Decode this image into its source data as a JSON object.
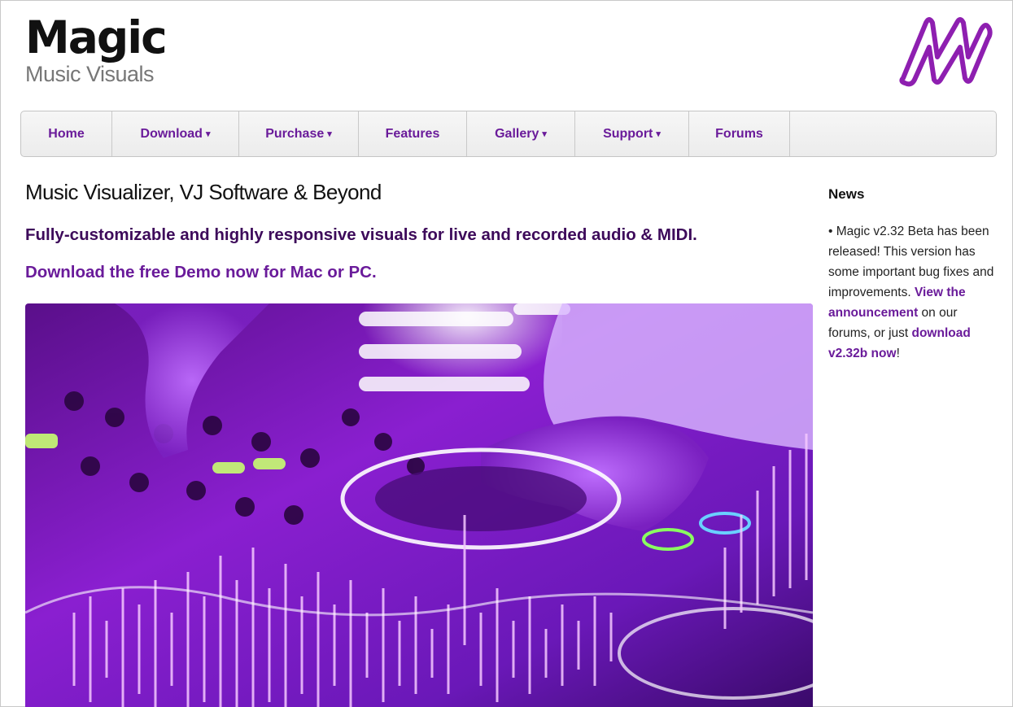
{
  "brand": {
    "title": "Magic",
    "subtitle": "Music Visuals"
  },
  "nav": {
    "items": [
      {
        "label": "Home",
        "caret": ""
      },
      {
        "label": "Download",
        "caret": "▾"
      },
      {
        "label": "Purchase",
        "caret": "▾"
      },
      {
        "label": "Features",
        "caret": ""
      },
      {
        "label": "Gallery",
        "caret": "▾"
      },
      {
        "label": "Support",
        "caret": "▾"
      },
      {
        "label": "Forums",
        "caret": ""
      }
    ]
  },
  "main": {
    "headline": "Music Visualizer, VJ Software & Beyond",
    "tagline": "Fully-customizable and highly responsive visuals for live and recorded audio & MIDI.",
    "demo_link": "Download the free Demo now for Mac or PC."
  },
  "news": {
    "title": "News",
    "text_1": "• Magic v2.32 Beta has been released! This version has some important bug fixes and improvements.",
    "link_1": "View the announcement",
    "text_2": " on our forums, or just ",
    "link_2": "download v2.32b now",
    "text_3": "!"
  },
  "colors": {
    "accent": "#6a1b9a",
    "tagline": "#3d0a5a",
    "nav_bg": "#efefef"
  },
  "icons": {
    "logo": "magic-m-logo-icon"
  }
}
